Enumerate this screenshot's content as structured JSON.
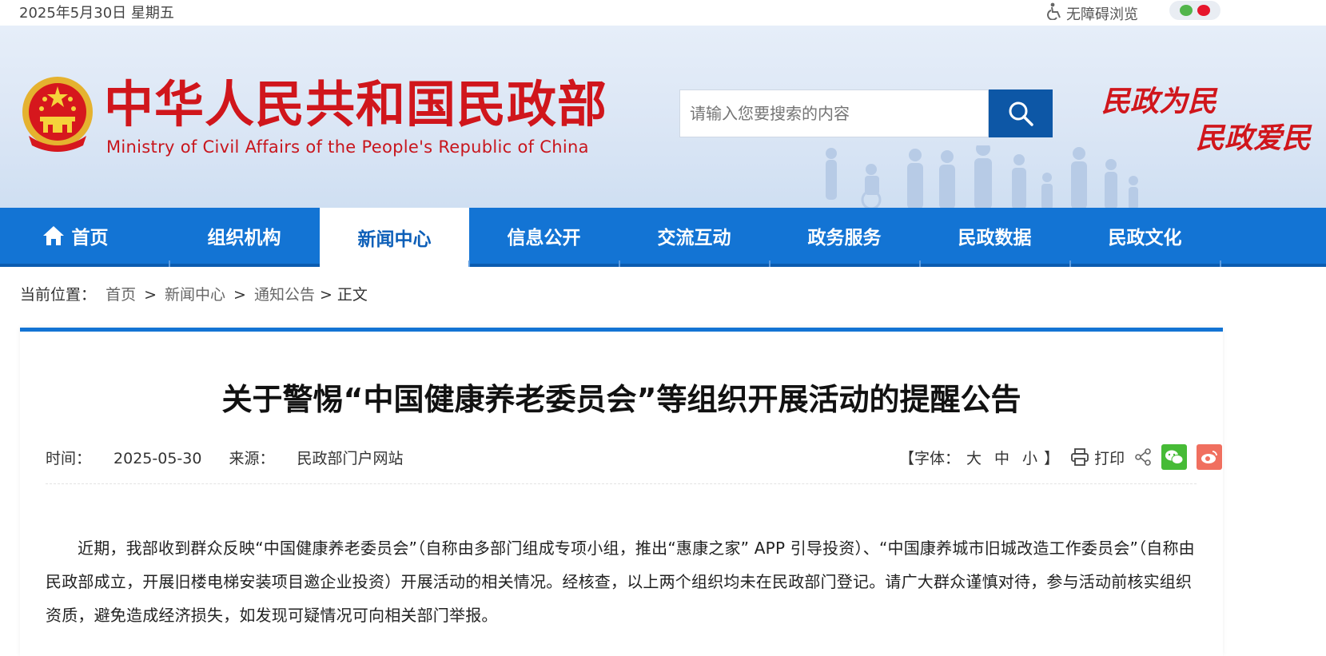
{
  "topbar": {
    "date": "2025年5月30日 星期五",
    "accessibility_label": "无障碍浏览",
    "social_icons": [
      "wechat-icon",
      "weibo-icon"
    ]
  },
  "header": {
    "title_cn": "中华人民共和国民政部",
    "title_en": "Ministry of Civil Affairs of the People's Republic of China",
    "search_placeholder": "请输入您要搜索的内容",
    "slogan_line1": "民政为民",
    "slogan_line2": "民政爱民",
    "colors": {
      "brand_red": "#d0161c",
      "nav_blue": "#1374d4",
      "search_blue": "#0d57a6"
    }
  },
  "nav": {
    "items": [
      {
        "label": "首页",
        "icon": "home-icon",
        "active": false
      },
      {
        "label": "组织机构",
        "active": false
      },
      {
        "label": "新闻中心",
        "active": true
      },
      {
        "label": "信息公开",
        "active": false
      },
      {
        "label": "交流互动",
        "active": false
      },
      {
        "label": "政务服务",
        "active": false
      },
      {
        "label": "民政数据",
        "active": false
      },
      {
        "label": "民政文化",
        "active": false
      }
    ]
  },
  "breadcrumb": {
    "prefix": "当前位置：",
    "items": [
      "首页",
      "新闻中心",
      "通知公告"
    ],
    "current": "正文",
    "separator": ">"
  },
  "article": {
    "title": "关于警惕“中国健康养老委员会”等组织开展活动的提醒公告",
    "time_label": "时间：",
    "time": "2025-05-30",
    "source_label": "来源：",
    "source": "民政部门户网站",
    "font_size_open": "【字体：",
    "font_sizes": [
      "大",
      "中",
      "小"
    ],
    "font_size_close": "】",
    "print_label": "打印",
    "body": "近期，我部收到群众反映“中国健康养老委员会”（自称由多部门组成专项小组，推出“惠康之家” APP 引导投资）、“中国康养城市旧城改造工作委员会”（自称由民政部成立，开展旧楼电梯安装项目邀企业投资）开展活动的相关情况。经核查，以上两个组织均未在民政部门登记。请广大群众谨慎对待，参与活动前核实组织资质，避免造成经济损失，如发现可疑情况可向相关部门举报。"
  }
}
